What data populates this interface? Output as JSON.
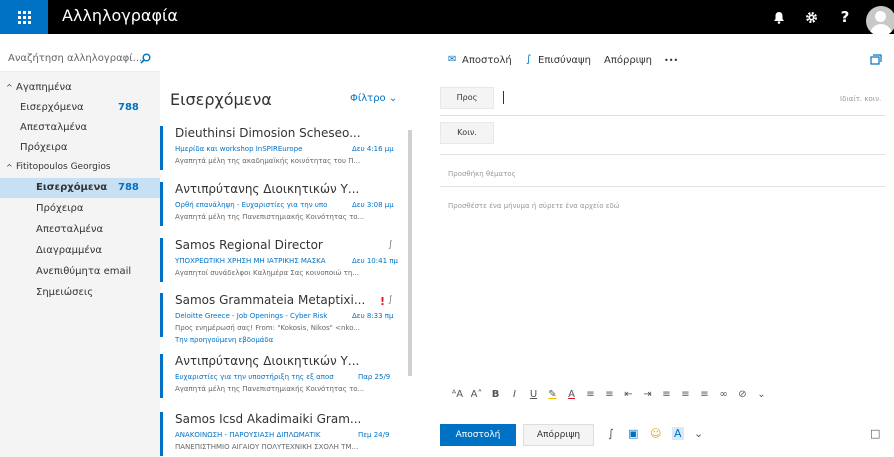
{
  "header": {
    "app_title": "Αλληλογραφία",
    "question": "?"
  },
  "search": {
    "placeholder": "Αναζήτηση αλληλογραφί..."
  },
  "folders": {
    "fav_heading": "Αγαπημένα",
    "fav_inbox": "Εισερχόμενα",
    "fav_inbox_count": "788",
    "fav_sent": "Απεσταλμένα",
    "fav_drafts": "Πρόχειρα",
    "account": "Fititopoulos Georgios",
    "inbox": "Εισερχόμενα",
    "inbox_count": "788",
    "drafts": "Πρόχειρα",
    "sent": "Απεσταλμένα",
    "deleted": "Διαγραμμένα",
    "junk": "Ανεπιθύμητα email",
    "notes": "Σημειώσεις"
  },
  "commands": {
    "send": "Αποστολή",
    "attach": "Επισύναψη",
    "discard": "Απόρριψη",
    "more": "•••"
  },
  "list": {
    "title": "Εισερχόμενα",
    "filter": "Φίλτρο",
    "divider": "Την προηγούμενη εβδομάδα",
    "messages": [
      {
        "sender": "Dieuthinsi Dimosion Scheseo...",
        "subject": "Ημερίδα και workshop InSPIREurope",
        "time": "Δευ 4:16 μμ",
        "preview": "Αγαπητά μέλη της ακαδημαϊκής κοινότητας του Π..."
      },
      {
        "sender": "Αντιπρύτανης Διοικητικών Υ...",
        "subject": "Ορθή επανάληψη - Ευχαριστίες για την υπο",
        "time": "Δευ 3:08 μμ",
        "preview": "Αγαπητά μέλη της Πανεπιστημιακής Κοινότητας το..."
      },
      {
        "sender": "Samos Regional Director",
        "subject": "ΥΠΟΧΡΕΩΤΙΚΗ ΧΡΗΣΗ ΜΗ ΙΑΤΡΙΚΗΣ ΜΑΣΚΑ",
        "time": "Δευ 10:41 πμ",
        "preview": "Αγαπητοί συνάδελφοι Καλημέρα Σας κοινοποιώ τη..."
      },
      {
        "sender": "Samos Grammateia Metaptixi...",
        "subject": "Deloitte Greece - Job Openings - Cyber Risk",
        "time": "Δευ 8:33 πμ",
        "preview": "Προς ενημέρωσή σας! From: \"Kokosis, Nikos\" <nko..."
      },
      {
        "sender": "Αντιπρύτανης Διοικητικών Υ...",
        "subject": "Ευχαριστίες για την υποστήριξη της εξ αποσ",
        "time": "Παρ 25/9",
        "preview": "Αγαπητά μέλη της Πανεπιστημιακής Κοινότητας το..."
      },
      {
        "sender": "Samos Icsd Akadimaiki Gram...",
        "subject": "ΑΝΑΚΟΙΝΩΣΗ - ΠΑΡΟΥΣΙΑΣΗ ΔΙΠΛΩΜΑΤΙΚ",
        "time": "Πεμ 24/9",
        "preview": "ΠΑΝΕΠΙΣΤΗΜΙΟ ΑΙΓΑΙΟΥ ΠΟΛΥΤΕΧΝΙΚΗ ΣΧΟΛΗ ΤΜ..."
      }
    ]
  },
  "compose": {
    "to_label": "Προς",
    "cc_label": "Κοιν.",
    "bcc_link": "Ιδιαίτ. κοιν.",
    "subject_placeholder": "Προσθήκη θέματος",
    "body_placeholder": "Προσθέστε ένα μήνυμα ή σύρετε ένα αρχείο εδώ",
    "send_button": "Αποστολή",
    "discard_button": "Απόρριψη"
  }
}
